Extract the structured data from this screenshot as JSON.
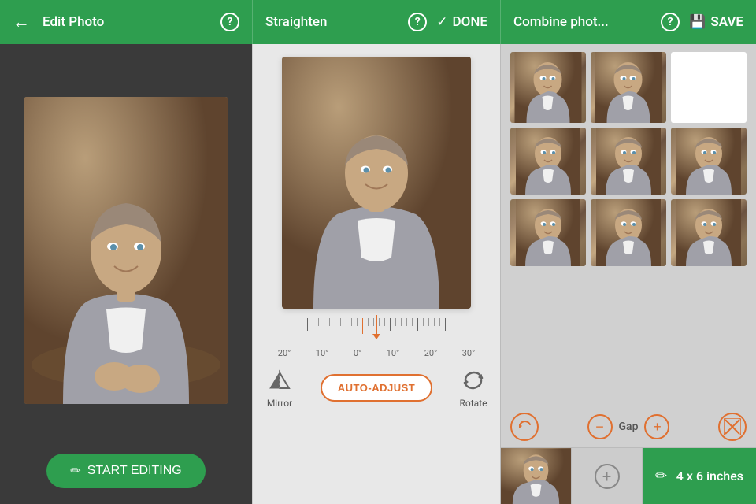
{
  "header": {
    "left": {
      "back_label": "←",
      "title": "Edit Photo",
      "help": "?"
    },
    "middle": {
      "title": "Straighten",
      "help": "?",
      "done_label": "DONE",
      "done_check": "✓"
    },
    "right": {
      "title": "Combine phot...",
      "help": "?",
      "save_label": "SAVE",
      "save_icon": "💾"
    }
  },
  "left_panel": {
    "start_editing_label": "START EDITING",
    "edit_icon": "✏️"
  },
  "middle_panel": {
    "angle_labels": [
      "20°",
      "10°",
      "0°",
      "10°",
      "20°",
      "30°"
    ],
    "auto_adjust_label": "AUTO-ADJUST",
    "mirror_label": "Mirror",
    "rotate_label": "Rotate"
  },
  "right_panel": {
    "gap_label": "Gap",
    "size_label": "4 x 6 inches"
  },
  "colors": {
    "green": "#2e9e4f",
    "orange": "#e07030",
    "bg_dark": "#3a3a3a",
    "bg_mid": "#e8e8e8",
    "bg_light": "#d0d0d0"
  }
}
